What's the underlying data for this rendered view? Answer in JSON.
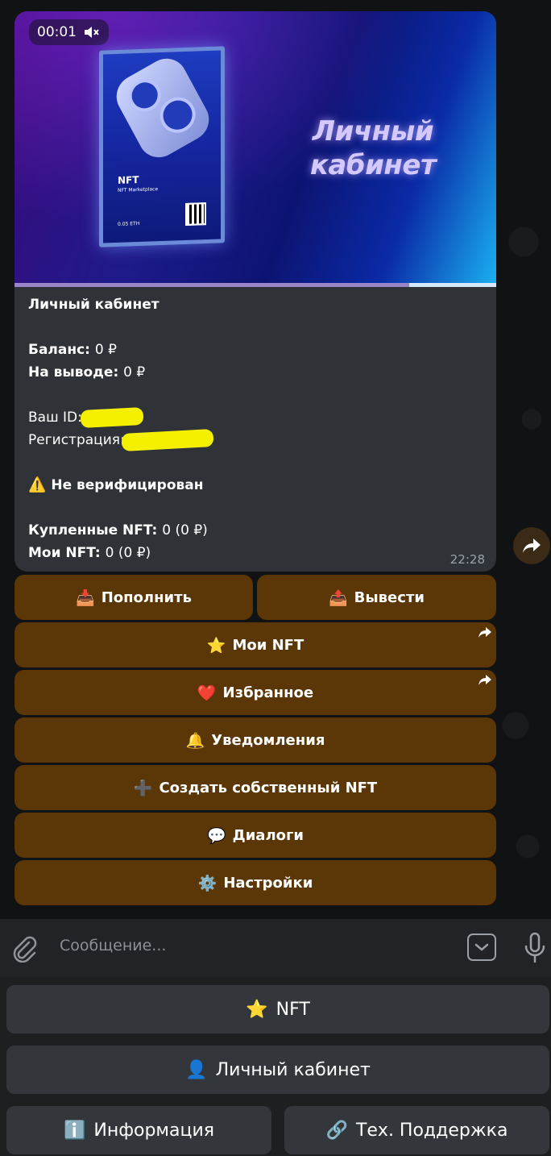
{
  "message": {
    "media": {
      "elapsed": "00:01",
      "title_line1": "Личный",
      "title_line2": "кабинет",
      "card_label": "NFT",
      "card_sublabel": "NFT Marketplace",
      "card_price": "0.05 ETH",
      "progress_percent": 82
    },
    "heading": "Личный кабинет",
    "balance_label": "Баланс:",
    "balance_value": "0 ₽",
    "withdraw_label": "На выводе:",
    "withdraw_value": "0 ₽",
    "id_label": "Ваш ID:",
    "registration_label": "Регистрация:",
    "verification_emoji": "⚠️",
    "verification_status": "Не верифицирован",
    "bought_nft_label": "Купленные NFT:",
    "bought_nft_value": "0 (0 ₽)",
    "my_nft_label": "Мои NFT:",
    "my_nft_value": "0 (0 ₽)",
    "time": "22:28"
  },
  "inline_keyboard": [
    {
      "emoji": "📥",
      "label": "Пополнить"
    },
    {
      "emoji": "📤",
      "label": "Вывести"
    },
    {
      "emoji": "⭐",
      "label": "Мои NFT"
    },
    {
      "emoji": "❤️",
      "label": "Избранное"
    },
    {
      "emoji": "🔔",
      "label": "Уведомления"
    },
    {
      "emoji": "➕",
      "label": "Создать собственный NFT"
    },
    {
      "emoji": "💬",
      "label": "Диалоги"
    },
    {
      "emoji": "⚙️",
      "label": "Настройки"
    }
  ],
  "input": {
    "placeholder": "Сообщение..."
  },
  "reply_keyboard": [
    {
      "emoji": "⭐",
      "label": "NFT"
    },
    {
      "emoji": "👤",
      "label": "Личный кабинет"
    },
    {
      "emoji": "ℹ️",
      "label": "Информация"
    },
    {
      "emoji": "🔗",
      "label": "Тех. Поддержка"
    }
  ],
  "colors": {
    "inline_button": "#623a06",
    "bubble": "#2f3337",
    "reply_button": "#33373b"
  }
}
